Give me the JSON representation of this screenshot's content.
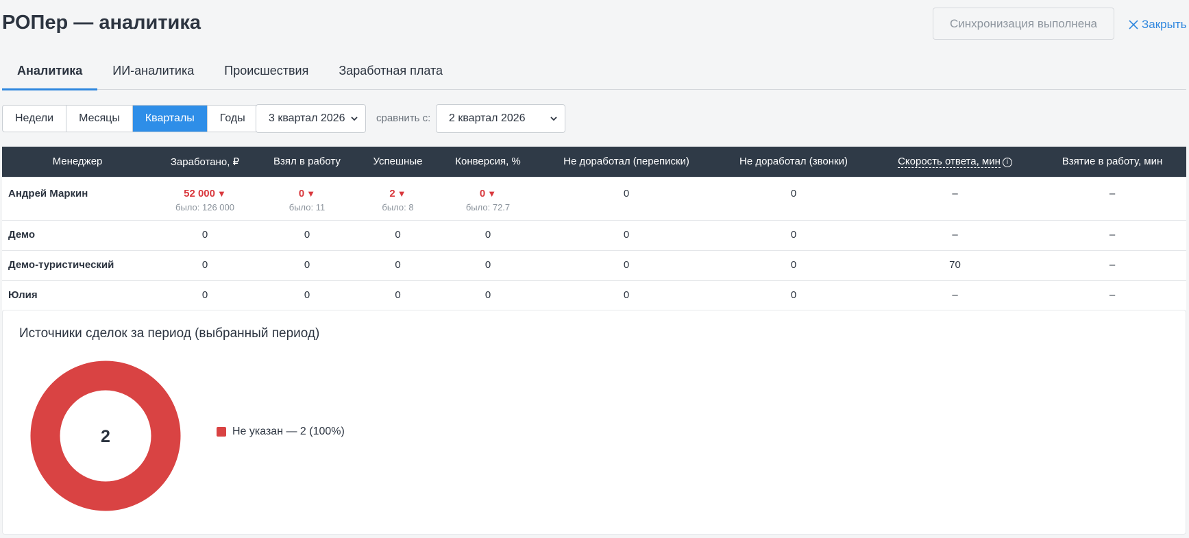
{
  "page_title": "РОПер — аналитика",
  "sync_label": "Синхронизация выполнена",
  "close_label": "Закрыть",
  "tabs": [
    {
      "label": "Аналитика",
      "active": true
    },
    {
      "label": "ИИ-аналитика",
      "active": false
    },
    {
      "label": "Происшествия",
      "active": false
    },
    {
      "label": "Заработная плата",
      "active": false
    }
  ],
  "periods": [
    {
      "label": "Недели",
      "active": false
    },
    {
      "label": "Месяцы",
      "active": false
    },
    {
      "label": "Кварталы",
      "active": true
    },
    {
      "label": "Годы",
      "active": false
    }
  ],
  "period_select": "3 квартал 2026",
  "compare_label": "сравнить с:",
  "compare_select": "2 квартал 2026",
  "table": {
    "headers": {
      "manager": "Менеджер",
      "earned": "Заработано, ₽",
      "taken": "Взял в работу",
      "success": "Успешные",
      "conversion": "Конверсия, %",
      "unworked_chats": "Не доработал (переписки)",
      "unworked_calls": "Не доработал (звонки)",
      "response_speed": "Скорость ответа, мин",
      "take_time": "Взятие в работу, мин"
    },
    "rows": [
      {
        "manager": "Андрей Маркин",
        "earned": "52 000",
        "earned_was": "было: 126 000",
        "taken": "0",
        "taken_was": "было: 11",
        "success": "2",
        "success_was": "было: 8",
        "conversion": "0",
        "conversion_was": "было: 72.7",
        "unworked_chats": "0",
        "unworked_calls": "0",
        "response_speed": "–",
        "take_time": "–"
      },
      {
        "manager": "Демо",
        "earned": "0",
        "taken": "0",
        "success": "0",
        "conversion": "0",
        "unworked_chats": "0",
        "unworked_calls": "0",
        "response_speed": "–",
        "take_time": "–"
      },
      {
        "manager": "Демо-туристический",
        "earned": "0",
        "taken": "0",
        "success": "0",
        "conversion": "0",
        "unworked_chats": "0",
        "unworked_calls": "0",
        "response_speed": "70",
        "take_time": "–"
      },
      {
        "manager": "Юлия",
        "earned": "0",
        "taken": "0",
        "success": "0",
        "conversion": "0",
        "unworked_chats": "0",
        "unworked_calls": "0",
        "response_speed": "–",
        "take_time": "–"
      }
    ]
  },
  "sources": {
    "title": "Источники сделок за период (выбранный период)",
    "total": "2",
    "legend": [
      {
        "label": "Не указан — 2 (100%)",
        "value": 2,
        "color": "#d94343"
      }
    ]
  },
  "colors": {
    "accent": "#2e86de",
    "negative": "#d9393e",
    "header_bg": "#2f3a47"
  }
}
